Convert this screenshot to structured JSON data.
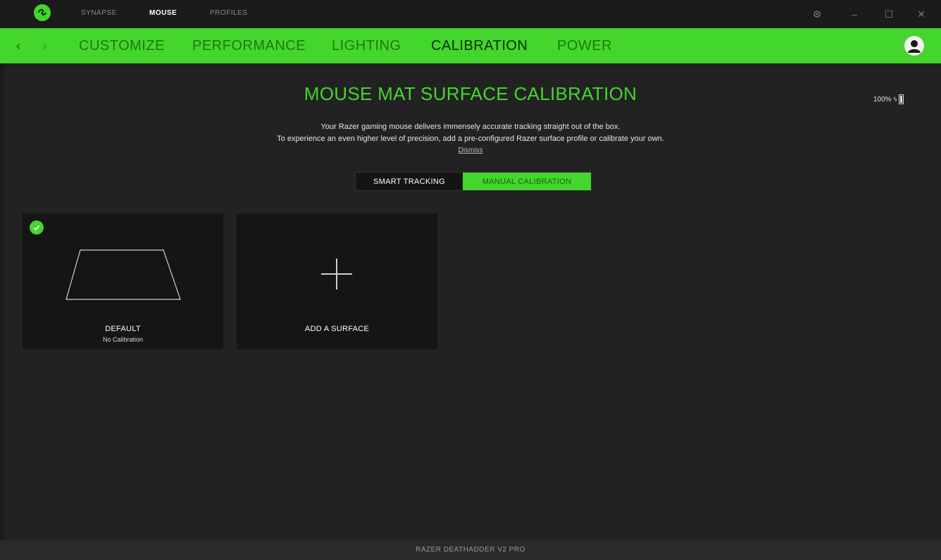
{
  "titlebar": {
    "tabs": [
      {
        "label": "SYNAPSE",
        "active": false
      },
      {
        "label": "MOUSE",
        "active": true
      },
      {
        "label": "PROFILES",
        "active": false
      }
    ],
    "controls": {
      "settings_icon": "gear-icon",
      "minimize": "–",
      "maximize": "☐",
      "close": "✕"
    }
  },
  "navbar": {
    "back": "‹",
    "forward": "›",
    "tabs": [
      {
        "label": "CUSTOMIZE",
        "active": false
      },
      {
        "label": "PERFORMANCE",
        "active": false
      },
      {
        "label": "LIGHTING",
        "active": false
      },
      {
        "label": "CALIBRATION",
        "active": true
      },
      {
        "label": "POWER",
        "active": false
      }
    ]
  },
  "main": {
    "title": "MOUSE MAT SURFACE CALIBRATION",
    "battery": {
      "label": "100%",
      "level": 1.0
    },
    "description_line1": "Your Razer gaming mouse delivers immensely accurate tracking straight out of the box.",
    "description_line2": "To experience an even higher level of precision, add a pre-configured Razer surface profile or calibrate your own.",
    "dismiss": "Dismiss",
    "toggle": {
      "smart": "SMART TRACKING",
      "manual": "MANUAL CALIBRATION",
      "selected": "manual"
    },
    "cards": [
      {
        "label": "DEFAULT",
        "sublabel": "No Calibration",
        "selected": true
      },
      {
        "label": "ADD A SURFACE",
        "sublabel": "",
        "selected": false
      }
    ]
  },
  "footer": {
    "device": "RAZER DEATHADDER V2 PRO"
  },
  "colors": {
    "accent": "#44d62c",
    "background": "#222222",
    "card": "#151515"
  }
}
